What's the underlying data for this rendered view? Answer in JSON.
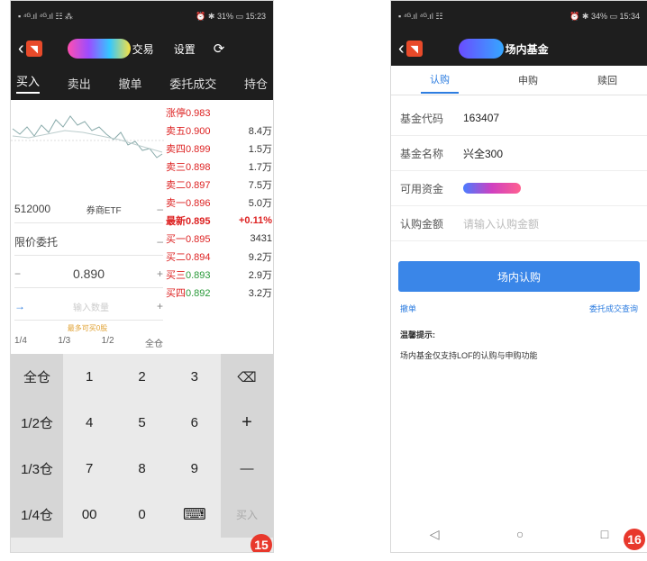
{
  "left": {
    "status": {
      "left": "▪ ⁴ᴳ.ıl ⁴ᴳ.ıl ☷ ⁂",
      "right": "⏰ ✱ 31% ▭ 15:23"
    },
    "title": {
      "text": "交易",
      "settings": "设置",
      "refresh": "⟳"
    },
    "tabs": [
      "买入",
      "卖出",
      "撤单",
      "委托成交",
      "持仓"
    ],
    "code": "512000",
    "fund_name": "券商ETF",
    "order_type": "限价委托",
    "price": "0.890",
    "qty_placeholder": "输入数量",
    "max_hint": "最多可买0股",
    "positions": [
      "1/4",
      "1/3",
      "1/2",
      "全仓"
    ],
    "orderbook": [
      {
        "label": "涨停",
        "price": "0.983",
        "vol": ""
      },
      {
        "label": "卖五",
        "price": "0.900",
        "vol": "8.4万"
      },
      {
        "label": "卖四",
        "price": "0.899",
        "vol": "1.5万"
      },
      {
        "label": "卖三",
        "price": "0.898",
        "vol": "1.7万"
      },
      {
        "label": "卖二",
        "price": "0.897",
        "vol": "7.5万"
      },
      {
        "label": "卖一",
        "price": "0.896",
        "vol": "5.0万"
      },
      {
        "label": "最新",
        "price": "0.895",
        "vol": "+0.11%"
      },
      {
        "label": "买一",
        "price": "0.895",
        "vol": "3431"
      },
      {
        "label": "买二",
        "price": "0.894",
        "vol": "9.2万"
      },
      {
        "label": "买三",
        "price": "0.893",
        "vol": "2.9万"
      },
      {
        "label": "买四",
        "price": "0.892",
        "vol": "3.2万"
      }
    ],
    "keypad": [
      [
        "全仓",
        "1",
        "2",
        "3",
        "⌫"
      ],
      [
        "1/2仓",
        "4",
        "5",
        "6",
        "+"
      ],
      [
        "1/3仓",
        "7",
        "8",
        "9",
        "—"
      ],
      [
        "1/4仓",
        "00",
        "0",
        "⌨",
        "买入"
      ]
    ],
    "badge": "15"
  },
  "right": {
    "status": {
      "left": "▪ ⁴ᴳ.ıl ⁴ᴳ.ıl ☷",
      "right": "⏰ ✱ 34% ▭ 15:34"
    },
    "title": "场内基金",
    "tabs": [
      "认购",
      "申购",
      "赎回"
    ],
    "fields": [
      {
        "k": "基金代码",
        "v": "163407"
      },
      {
        "k": "基金名称",
        "v": "兴全300"
      },
      {
        "k": "可用资金",
        "v": ""
      },
      {
        "k": "认购金额",
        "v": "",
        "placeholder": "请输入认购金额"
      }
    ],
    "button": "场内认购",
    "link_left": "撤单",
    "link_right": "委托成交查询",
    "tip_title": "温馨提示:",
    "tip_text": "场内基金仅支持LOF的认购与申购功能",
    "nav": [
      "◁",
      "○",
      "□"
    ],
    "badge": "16"
  }
}
